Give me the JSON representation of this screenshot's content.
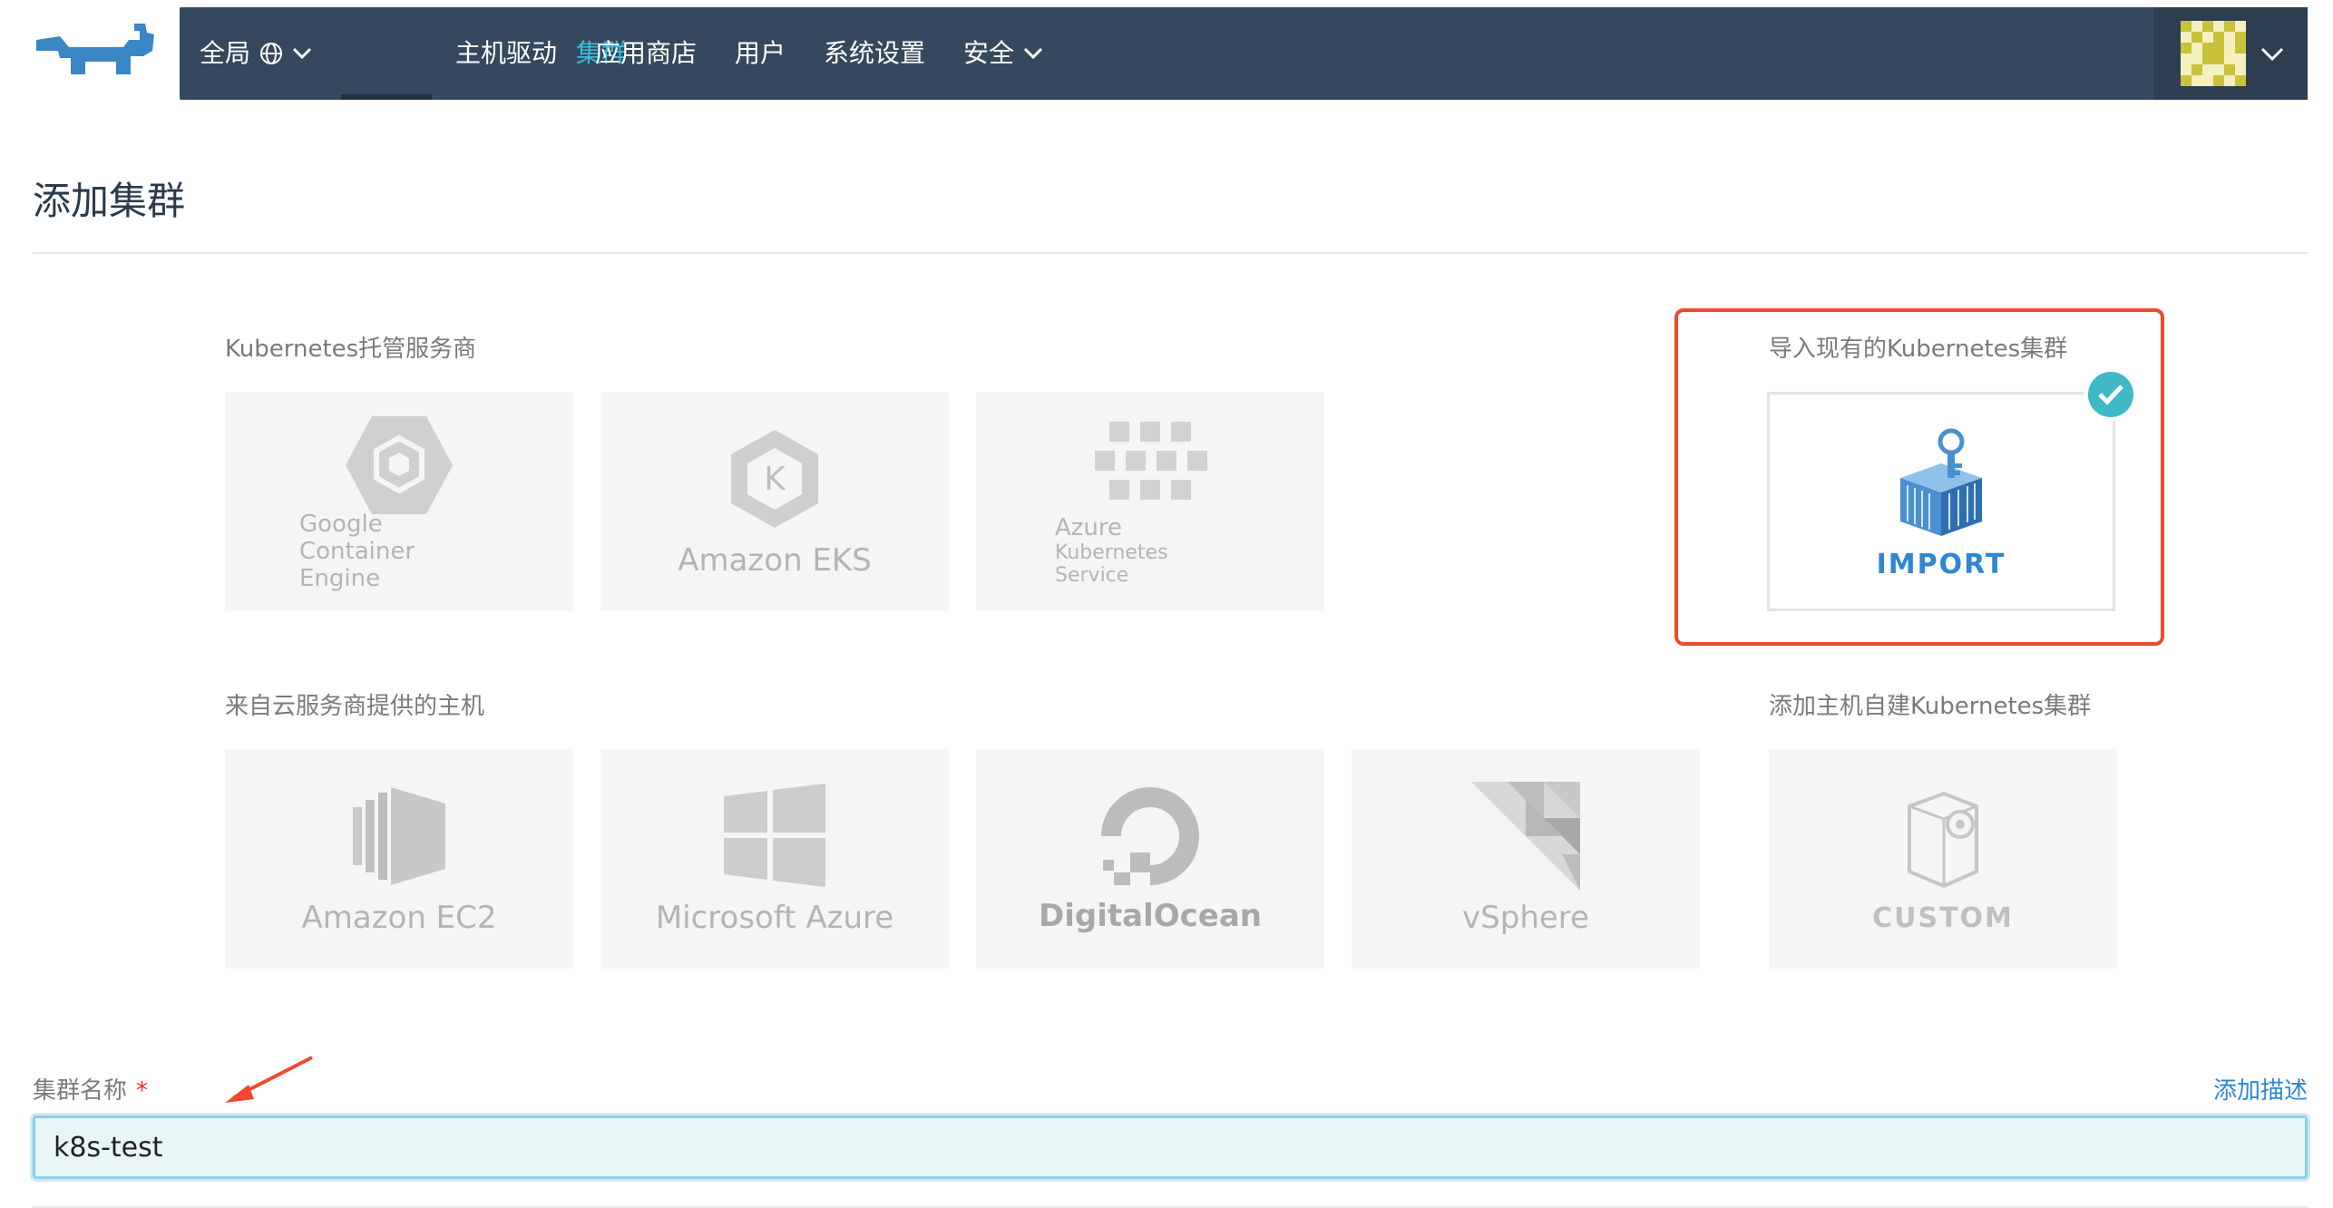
{
  "nav": {
    "global_label": "全局",
    "items": [
      "集群",
      "主机驱动",
      "应用商店",
      "用户",
      "系统设置",
      "安全"
    ]
  },
  "page": {
    "title": "添加集群"
  },
  "sections": {
    "hosted": "Kubernetes托管服务商",
    "import": "导入现有的Kubernetes集群",
    "cloud": "来自云服务商提供的主机",
    "custom": "添加主机自建Kubernetes集群"
  },
  "providers": {
    "gke": {
      "line1": "Google",
      "line2": "Container Engine"
    },
    "eks": "Amazon EKS",
    "aks": {
      "line1": "Azure",
      "line2": "Kubernetes Service"
    },
    "import": "IMPORT",
    "ec2": "Amazon EC2",
    "azure": "Microsoft Azure",
    "digitalocean": "DigitalOcean",
    "vsphere": "vSphere",
    "custom": "CUSTOM"
  },
  "form": {
    "cluster_name_label": "集群名称",
    "required_mark": "*",
    "add_description": "添加描述",
    "cluster_name_value": "k8s-test"
  },
  "colors": {
    "nav_bg": "#34495e",
    "accent": "#3dbbd8",
    "highlight": "#ef4a2b",
    "link": "#2d87d4"
  }
}
